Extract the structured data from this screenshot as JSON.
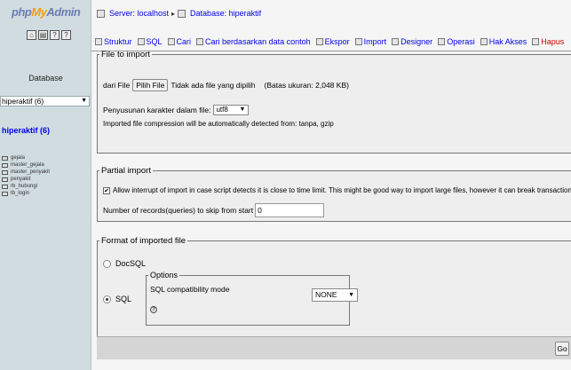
{
  "nav": {
    "logo_php": "php",
    "logo_my": "My",
    "logo_admin": "Admin",
    "icons": [
      "home-icon",
      "query-window-icon",
      "docs-icon",
      "sql-docs-icon"
    ],
    "database_label": "Database",
    "database_select": "hiperaktif (6)",
    "database_link": "hiperaktif (6)",
    "tables": [
      "gejala",
      "master_gejala",
      "master_penyakit",
      "penyakit",
      "rb_hubungi",
      "tb_login"
    ]
  },
  "breadcrumb": {
    "server": "Server: localhost",
    "database": "Database: hiperaktif"
  },
  "tabs": [
    {
      "label": "Struktur"
    },
    {
      "label": "SQL"
    },
    {
      "label": "Cari"
    },
    {
      "label": "Cari berdasarkan data contoh"
    },
    {
      "label": "Ekspor"
    },
    {
      "label": "Import"
    },
    {
      "label": "Designer"
    },
    {
      "label": "Operasi"
    },
    {
      "label": "Hak Akses"
    },
    {
      "label": "Hapus"
    }
  ],
  "file_import": {
    "legend": "File to import",
    "from_label": "dari File",
    "choose_button": "Pilih File",
    "no_file": "Tidak ada file yang dipilih",
    "size_limit": "(Batas ukuran: 2,048 KB)",
    "charset_label": "Penyusunan karakter dalam file:",
    "charset_value": "utf8",
    "compression_note": "Imported file compression will be automatically detected from: tanpa, gzip"
  },
  "partial_import": {
    "legend": "Partial import",
    "allow_interrupt": "Allow interrupt of import in case script detects it is close to time limit. This might be good way to import large files, however it can break transactions.",
    "allow_interrupt_checked": "✔",
    "skip_label": "Number of records(queries) to skip from start",
    "skip_value": "0"
  },
  "format": {
    "legend": "Format of imported file",
    "docsql_label": "DocSQL",
    "sql_label": "SQL",
    "options_legend": "Options",
    "compat_label": "SQL compatibility mode",
    "compat_value": "NONE"
  },
  "go_button": "Go",
  "colors": {
    "nav_bg": "#d0dce0",
    "link": "#0000ee",
    "danger": "#cc0000",
    "panel_bg": "#eeeeee"
  }
}
